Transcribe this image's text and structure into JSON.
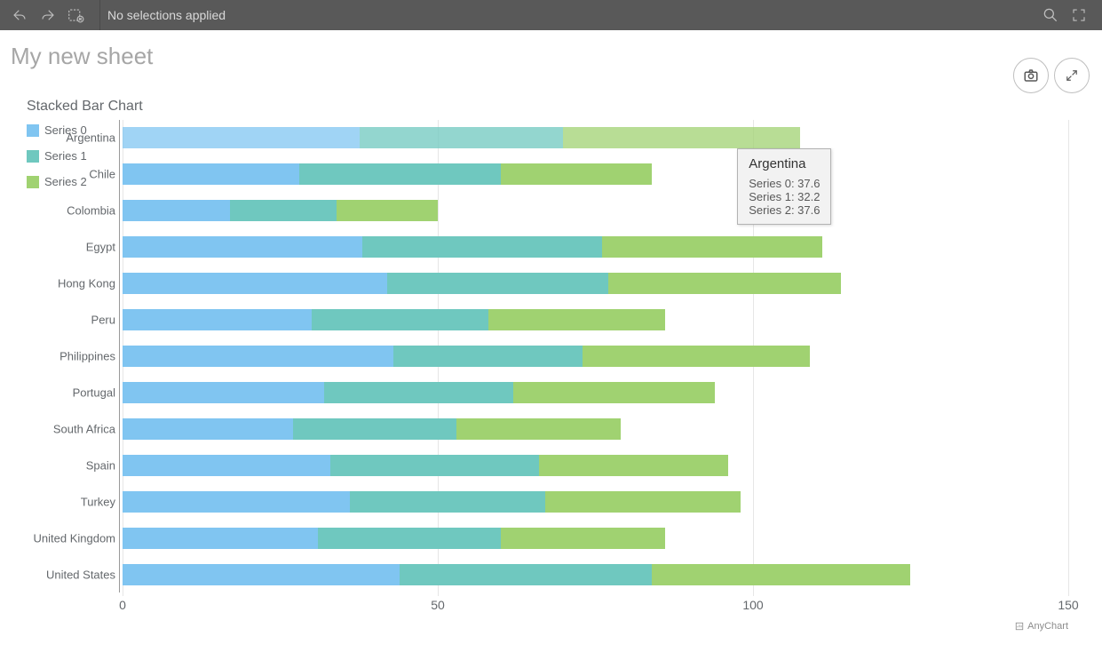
{
  "toolbar": {
    "selections_text": "No selections applied"
  },
  "sheet": {
    "title": "My new sheet"
  },
  "chart_data": {
    "type": "bar",
    "title": "Stacked Bar Chart",
    "stacked": true,
    "orientation": "horizontal",
    "colors": [
      "#80c5f1",
      "#6fc8bf",
      "#a0d271"
    ],
    "legend": [
      "Series 0",
      "Series 1",
      "Series 2"
    ],
    "categories": [
      "Argentina",
      "Chile",
      "Colombia",
      "Egypt",
      "Hong Kong",
      "Peru",
      "Philippines",
      "Portugal",
      "South Africa",
      "Spain",
      "Turkey",
      "United Kingdom",
      "United States"
    ],
    "series": [
      {
        "name": "Series 0",
        "values": [
          37.6,
          28.0,
          17.0,
          38.0,
          42.0,
          30.0,
          43.0,
          32.0,
          27.0,
          33.0,
          36.0,
          31.0,
          44.0
        ]
      },
      {
        "name": "Series 1",
        "values": [
          32.2,
          32.0,
          17.0,
          38.0,
          35.0,
          28.0,
          30.0,
          30.0,
          26.0,
          33.0,
          31.0,
          29.0,
          40.0
        ]
      },
      {
        "name": "Series 2",
        "values": [
          37.6,
          24.0,
          16.0,
          35.0,
          37.0,
          28.0,
          36.0,
          32.0,
          26.0,
          30.0,
          31.0,
          26.0,
          41.0
        ]
      }
    ],
    "x_ticks": [
      0,
      50,
      100,
      150
    ],
    "xlim": [
      0,
      150
    ],
    "highlighted_index": 0,
    "tooltip": {
      "title": "Argentina",
      "lines": [
        "Series 0: 37.6",
        "Series 1: 32.2",
        "Series 2: 37.6"
      ]
    },
    "credit": "AnyChart"
  }
}
